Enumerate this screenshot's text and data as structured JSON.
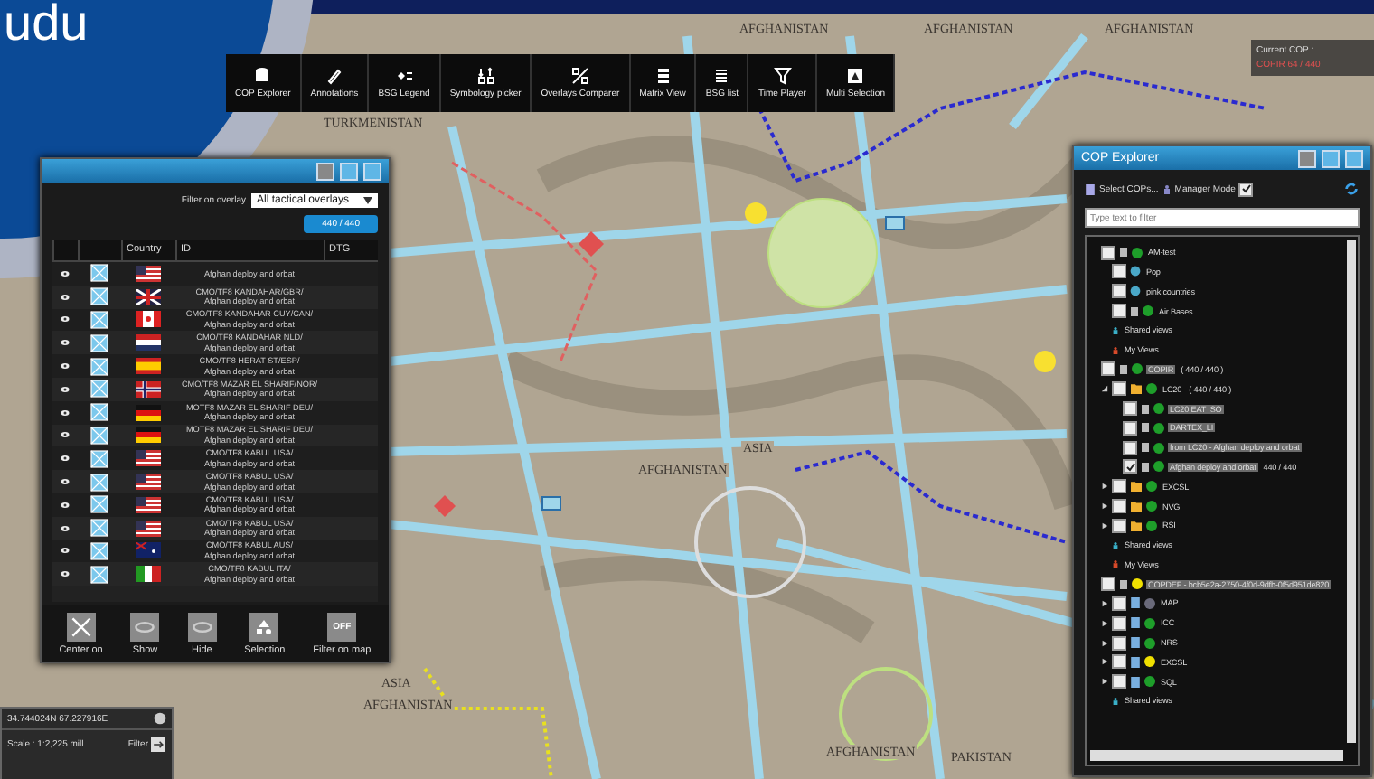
{
  "logo_text": "udu",
  "map_labels": [
    "AFGHANISTAN",
    "AFGHANISTAN",
    "AFGHANISTAN",
    "TURKMENISTAN",
    "ASIA",
    "AFGHANISTAN",
    "ASIA",
    "AFGHANISTAN",
    "AFGHANISTAN",
    "PAKISTAN"
  ],
  "current_cop": {
    "label": "Current COP :",
    "value": "COPIR 64 / 440"
  },
  "toolbar": [
    "COP Explorer",
    "Annotations",
    "BSG Legend",
    "Symbology picker",
    "Overlays Comparer",
    "Matrix View",
    "BSG list",
    "Time Player",
    "Multi Selection"
  ],
  "overlay_panel": {
    "filter_label": "Filter on overlay",
    "filter_value": "All tactical overlays",
    "count": "440 / 440",
    "columns": [
      "Country",
      "ID",
      "DTG"
    ],
    "rows": [
      {
        "kind": "us",
        "id": "",
        "name": "Afghan deploy and orbat"
      },
      {
        "kind": "gb",
        "id": "CMO/TF8 KANDAHAR/GBR/",
        "name": "Afghan deploy and orbat"
      },
      {
        "kind": "ca",
        "id": "CMO/TF8 KANDAHAR CUY/CAN/",
        "name": "Afghan deploy and orbat"
      },
      {
        "kind": "nl",
        "id": "CMO/TF8 KANDAHAR NLD/",
        "name": "Afghan deploy and orbat"
      },
      {
        "kind": "es",
        "id": "CMO/TF8 HERAT ST/ESP/",
        "name": "Afghan deploy and orbat"
      },
      {
        "kind": "no",
        "id": "CMO/TF8 MAZAR EL SHARIF/NOR/",
        "name": "Afghan deploy and orbat"
      },
      {
        "kind": "de",
        "id": "MOTF8 MAZAR EL SHARIF DEU/",
        "name": "Afghan deploy and orbat"
      },
      {
        "kind": "de",
        "id": "MOTF8 MAZAR EL SHARIF DEU/",
        "name": "Afghan deploy and orbat"
      },
      {
        "kind": "us",
        "id": "CMO/TF8 KABUL USA/",
        "name": "Afghan deploy and orbat"
      },
      {
        "kind": "us",
        "id": "CMO/TF8 KABUL USA/",
        "name": "Afghan deploy and orbat"
      },
      {
        "kind": "us",
        "id": "CMO/TF8 KABUL USA/",
        "name": "Afghan deploy and orbat"
      },
      {
        "kind": "us",
        "id": "CMO/TF8 KABUL USA/",
        "name": "Afghan deploy and orbat"
      },
      {
        "kind": "au",
        "id": "CMO/TF8 KABUL AUS/",
        "name": "Afghan deploy and orbat"
      },
      {
        "kind": "it",
        "id": "CMO/TF8 KABUL ITA/",
        "name": "Afghan deploy and orbat"
      }
    ],
    "actions": [
      {
        "label": "Center on"
      },
      {
        "label": "Show"
      },
      {
        "label": "Hide"
      },
      {
        "label": "Selection"
      },
      {
        "label": "Filter on map",
        "badge": "OFF"
      }
    ]
  },
  "position_panel": {
    "coordinates": "34.744024N 67.227916E",
    "scale": "Scale : 1:2,225 mill",
    "filter": "Filter"
  },
  "explorer": {
    "title": "COP Explorer",
    "select": "Select COPs...",
    "manager": "Manager Mode",
    "manager_checked": true,
    "placeholder": "Type text to filter",
    "tree": [
      {
        "label": "AM-test",
        "kind": "file",
        "color": "#1e9e2a",
        "checked": false,
        "children": [
          {
            "label": "Pop",
            "kind": "globe",
            "checked": false
          },
          {
            "label": "pink countries",
            "kind": "globe",
            "checked": false
          },
          {
            "label": "Air Bases",
            "kind": "file",
            "color": "#1e9e2a",
            "checked": false
          },
          {
            "label": "Shared views",
            "kind": "shared"
          },
          {
            "label": "My Views",
            "kind": "views"
          }
        ]
      },
      {
        "label": "COPIR",
        "count": "( 440 / 440 )",
        "kind": "file",
        "color": "#1e9e2a",
        "checked": false,
        "highlight": true,
        "children": [
          {
            "label": "LC20",
            "count": "( 440 / 440 )",
            "kind": "folder",
            "color": "#1e9e2a",
            "checked": false,
            "expanded": true,
            "children": [
              {
                "label": "LC20 EAT ISO",
                "kind": "file",
                "color": "#1e9e2a",
                "checked": false,
                "highlight": true
              },
              {
                "label": "DARTEX_LI",
                "kind": "file",
                "color": "#1e9e2a",
                "checked": false,
                "highlight": true
              },
              {
                "label": "from LC20 - Afghan deploy and orbat",
                "kind": "file",
                "color": "#1e9e2a",
                "checked": false,
                "highlight": true
              },
              {
                "label": "Afghan deploy and orbat",
                "count": "440 / 440",
                "kind": "file",
                "color": "#1e9e2a",
                "checked": true,
                "highlight": true
              }
            ]
          },
          {
            "label": "EXCSL",
            "kind": "folder",
            "color": "#1e9e2a",
            "checked": false,
            "expanded": false
          },
          {
            "label": "NVG",
            "kind": "folder",
            "color": "#1e9e2a",
            "checked": false,
            "expanded": false
          },
          {
            "label": "RSI",
            "kind": "folder",
            "color": "#1e9e2a",
            "checked": false,
            "expanded": false
          },
          {
            "label": "Shared views",
            "kind": "shared"
          },
          {
            "label": "My Views",
            "kind": "views"
          }
        ]
      },
      {
        "label": "COPDEF - bcb5e2a-2750-4f0d-9dfb-0f5d951de820",
        "kind": "file",
        "color": "#f0e000",
        "checked": false,
        "highlight": true,
        "children": [
          {
            "label": "MAP",
            "kind": "doc",
            "color": "#6a6a7a",
            "checked": false,
            "expanded": false
          },
          {
            "label": "ICC",
            "kind": "doc",
            "color": "#1e9e2a",
            "checked": false,
            "expanded": false
          },
          {
            "label": "NRS",
            "kind": "doc",
            "color": "#1e9e2a",
            "checked": false,
            "expanded": false
          },
          {
            "label": "EXCSL",
            "kind": "doc",
            "color": "#f0e000",
            "checked": false,
            "expanded": false
          },
          {
            "label": "SQL",
            "kind": "doc",
            "color": "#1e9e2a",
            "checked": false,
            "expanded": false
          },
          {
            "label": "Shared views",
            "kind": "shared"
          }
        ]
      }
    ]
  }
}
